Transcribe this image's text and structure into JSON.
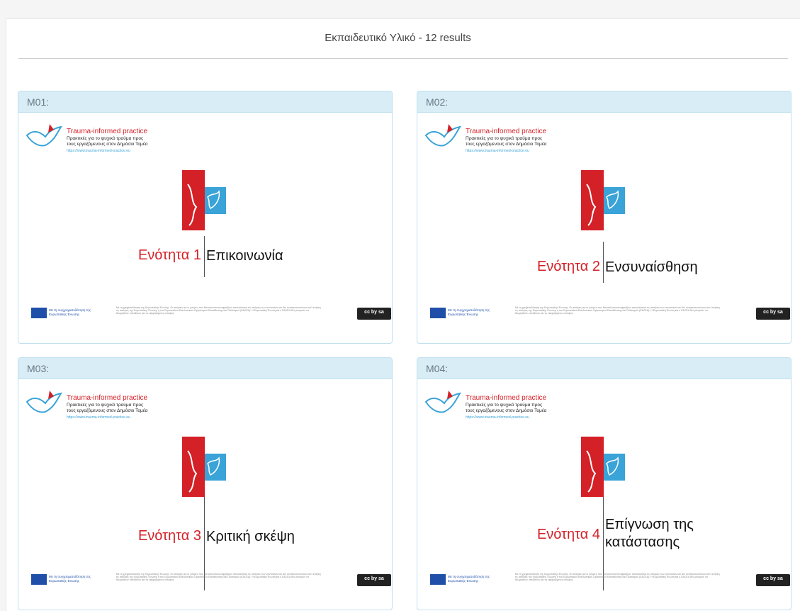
{
  "results_title": "Εκπαιδευτικό Υλικό - 12 results",
  "brand": {
    "title": "Trauma-informed practice",
    "subtitle": "Πρακτικές για το ψυχικό τραύμα προς τους εργαζόμενους στον Δημόσιο Τομέα",
    "url": "https://www.trauma-informed-practice.eu"
  },
  "footer": {
    "eu_text": "Με τη συγχρηματοδότηση της Ευρωπαϊκής Ένωσης",
    "disclaimer": "Με τη χρηματοδότηση της Ευρωπαϊκής Ένωσης. Οι απόψεις και οι γνώμες που διατυπώνονται εκφράζουν αποκλειστικά τις απόψεις των συντακτών και δεν αντιπροσωπεύουν κατ' ανάγκη τις απόψεις της Ευρωπαϊκής Ένωσης ή του Ευρωπαϊκού Εκτελεστικού Οργανισμού Εκπαίδευσης και Πολιτισμού (EACEA). Η Ευρωπαϊκή Ένωση και ο EACEA δεν μπορούν να θεωρηθούν υπεύθυνοι για τις εκφραζόμενες απόψεις.",
    "license": "cc by sa"
  },
  "colors": {
    "accent_red": "#d42027",
    "accent_blue": "#3aa3d8",
    "header_bg": "#d9edf7"
  },
  "modules": [
    {
      "code": "M01:",
      "unit": "Ενότητα 1",
      "topic": "Επικοινωνία"
    },
    {
      "code": "M02:",
      "unit": "Ενότητα 2",
      "topic": "Ενσυναίσθηση"
    },
    {
      "code": "M03:",
      "unit": "Ενότητα 3",
      "topic": "Κριτική σκέψη"
    },
    {
      "code": "M04:",
      "unit": "Ενότητα 4",
      "topic": "Επίγνωση της κατάστασης"
    }
  ]
}
